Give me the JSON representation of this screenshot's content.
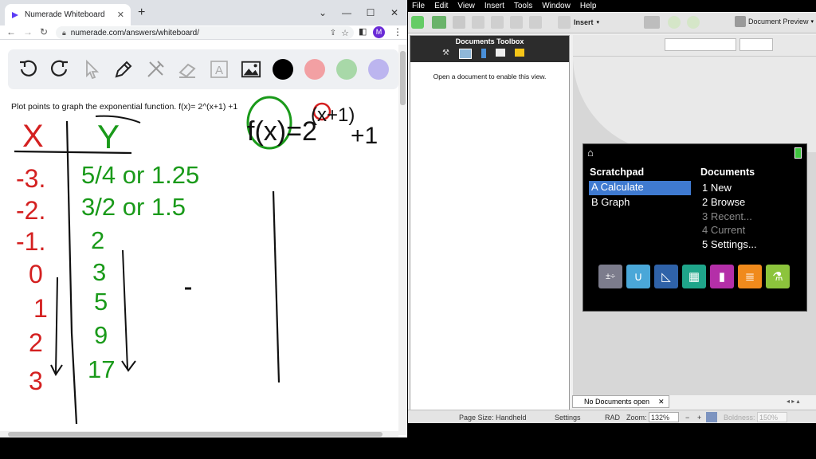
{
  "browser": {
    "tab_title": "Numerade Whiteboard",
    "url": "numerade.com/answers/whiteboard/",
    "avatar_letter": "M",
    "colors": {
      "red": "#f2a0a3",
      "green": "#a8d8a8",
      "purple": "#bcb5ef",
      "black": "#000000"
    }
  },
  "whiteboard": {
    "problem_text": "Plot points to graph the exponential function. f(x)= 2^(x+1) +1",
    "table": {
      "x_header": "X",
      "y_header": "Y",
      "x_values": [
        "-3.",
        "-2.",
        "-1.",
        "0",
        "1",
        "2",
        "3"
      ],
      "y_values": [
        "5/4 or 1.25",
        "3/2 or 1.5",
        "2",
        "3",
        "5",
        "9",
        "17"
      ]
    },
    "equation": "f(x)=2",
    "exponent": "(x+1)",
    "equation_tail": "+1"
  },
  "ti": {
    "menu": [
      "File",
      "Edit",
      "View",
      "Insert",
      "Tools",
      "Window",
      "Help"
    ],
    "insert_label": "Insert",
    "doc_preview": "Document Preview",
    "toolbox_title": "Documents Toolbox",
    "toolbox_message": "Open a document to enable this view.",
    "handheld": {
      "scratchpad_header": "Scratchpad",
      "documents_header": "Documents",
      "scratchpad_items": [
        "A  Calculate",
        "B  Graph"
      ],
      "document_items": [
        "1  New",
        "2  Browse",
        "3  Recent...",
        "4  Current",
        "5  Settings..."
      ]
    },
    "doc_tab": "No Documents open",
    "status": {
      "page_size": "Page Size: Handheld",
      "settings": "Settings",
      "rad": "RAD",
      "zoom_label": "Zoom:",
      "zoom_value": "132%",
      "boldness_label": "Boldness:",
      "boldness_value": "150%"
    }
  }
}
